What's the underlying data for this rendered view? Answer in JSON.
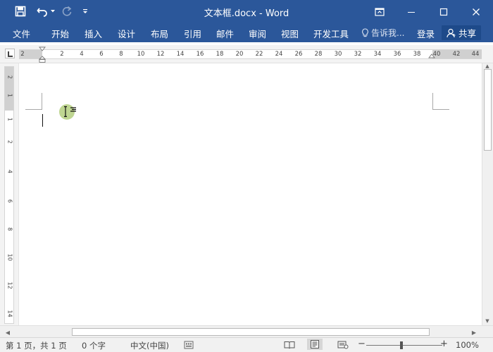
{
  "window": {
    "title": "文本框.docx - Word"
  },
  "quick_access": {
    "save_icon": "save-icon",
    "undo_icon": "undo-icon",
    "redo_icon": "redo-icon",
    "customize_icon": "chevron-down-icon"
  },
  "ribbon": {
    "tabs": [
      "文件",
      "开始",
      "插入",
      "设计",
      "布局",
      "引用",
      "邮件",
      "审阅",
      "视图",
      "开发工具"
    ],
    "tell_me": "告诉我...",
    "login": "登录",
    "share": "共享"
  },
  "ruler": {
    "horizontal_numbers": [
      "2",
      "2",
      "4",
      "6",
      "8",
      "10",
      "12",
      "14",
      "16",
      "18",
      "20",
      "22",
      "24",
      "26",
      "28",
      "30",
      "32",
      "34",
      "36",
      "38",
      "40",
      "42",
      "44"
    ],
    "vertical_numbers": [
      "2",
      "1",
      "1",
      "2",
      "4",
      "6",
      "8",
      "10",
      "12",
      "14"
    ]
  },
  "statusbar": {
    "page": "第 1 页，共 1 页",
    "words": "0 个字",
    "language": "中文(中国)",
    "zoom": "100%",
    "zoom_minus": "−",
    "zoom_plus": "+"
  },
  "colors": {
    "accent": "#2b579a",
    "share_bg": "#1e4a8a"
  }
}
